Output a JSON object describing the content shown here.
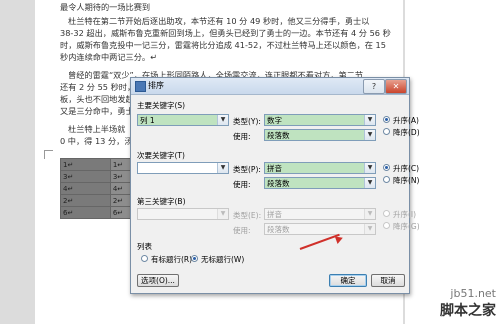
{
  "document": {
    "lines": [
      "最令人期待的一场比赛到",
      "杜兰特在第二节开始后逐出助攻，本节还有 10 分 49 秒时，他又三分得手，勇士以",
      "38-32 超出，威斯布鲁克重新回到场上，但勇头已经到了勇士的一边。本节还有 4 分 56 秒",
      "时，威斯布鲁克投中一记三分，雷霆将比分追成 41-52，不过杜兰特马上还以颜色，在 15",
      "秒内连续命中两记三分。↵",
      "曾经的雷霆“双少”，在场上形同陌路人，全场零交流，连正眼都不看对方，第二节",
      "还有 2 分 55 秒时，",
      "板，头也不回地发起",
      "又是三分命中，勇士",
      "杜兰特上半场就",
      "0 中，得 13 分，汤普"
    ],
    "table": [
      [
        "1↵",
        "1↵"
      ],
      [
        "3↵",
        "3↵"
      ],
      [
        "4↵",
        "4↵"
      ],
      [
        "2↵",
        "2↵"
      ],
      [
        "6↵",
        "6↵"
      ]
    ]
  },
  "dialog": {
    "title": "排序",
    "help": "?",
    "close": "✕",
    "primary": {
      "label": "主要关键字(S)",
      "field": "列 1",
      "type_label": "类型(Y):",
      "type_value": "数字",
      "using_label": "使用:",
      "using_value": "段落数",
      "asc": "升序(A)",
      "desc": "降序(D)"
    },
    "secondary": {
      "label": "次要关键字(T)",
      "field": "",
      "type_label": "类型(P):",
      "type_value": "拼音",
      "using_label": "使用:",
      "using_value": "段落数",
      "asc": "升序(C)",
      "desc": "降序(N)"
    },
    "tertiary": {
      "label": "第三关键字(B)",
      "field": "",
      "type_label": "类型(E):",
      "type_value": "拼音",
      "using_label": "使用:",
      "using_value": "段落数",
      "asc": "升序(I)",
      "desc": "降序(G)"
    },
    "list": {
      "label": "列表",
      "header_row": "有标题行(R)",
      "no_header_row": "无标题行(W)"
    },
    "options_button": "选项(O)...",
    "ok_button": "确定",
    "cancel_button": "取消"
  },
  "watermark": {
    "url": "jb51.net",
    "name": "脚本之家"
  },
  "colors": {
    "highlight_green": "#bfe3c0",
    "annotation_arrow": "#d0302a"
  }
}
